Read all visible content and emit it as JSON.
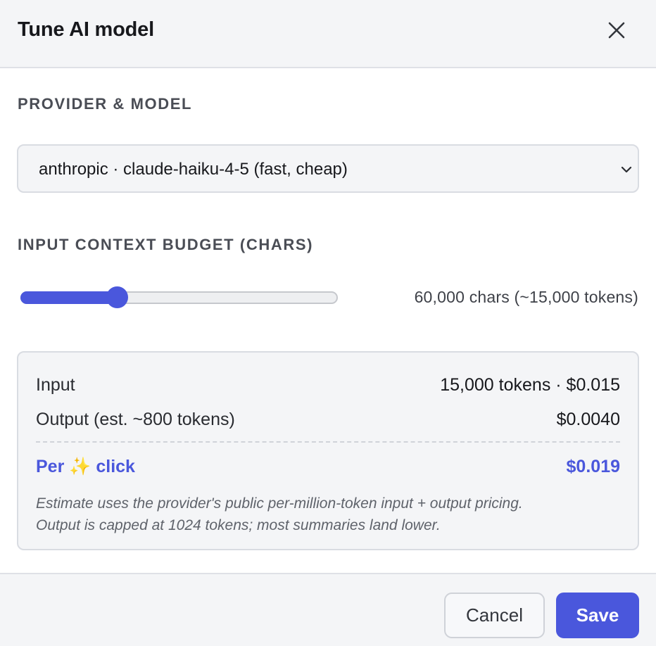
{
  "dialog": {
    "title": "Tune AI model",
    "close_icon": "close-icon"
  },
  "provider": {
    "section_label": "PROVIDER & MODEL",
    "selected": "anthropic · claude-haiku-4-5 (fast, cheap)",
    "chevron_icon": "chevron-down-icon"
  },
  "budget": {
    "section_label": "INPUT CONTEXT BUDGET (CHARS)",
    "slider_fraction": 0.29,
    "readout": "60,000 chars (~15,000 tokens)"
  },
  "cost": {
    "input_label": "Input",
    "input_value": "15,000 tokens · $0.015",
    "output_label": "Output (est. ~800 tokens)",
    "output_value": "$0.0040",
    "total_label_pre": "Per",
    "total_label_icon": "✨",
    "total_label_post": "click",
    "total_value": "$0.019",
    "note_line1": "Estimate uses the provider's public per-million-token input + output pricing.",
    "note_line2": "Output is capped at 1024 tokens; most summaries land lower."
  },
  "footer": {
    "cancel_label": "Cancel",
    "save_label": "Save"
  },
  "colors": {
    "accent": "#4a57dc",
    "panel_bg": "#f4f5f7",
    "border": "#d9dce2"
  }
}
